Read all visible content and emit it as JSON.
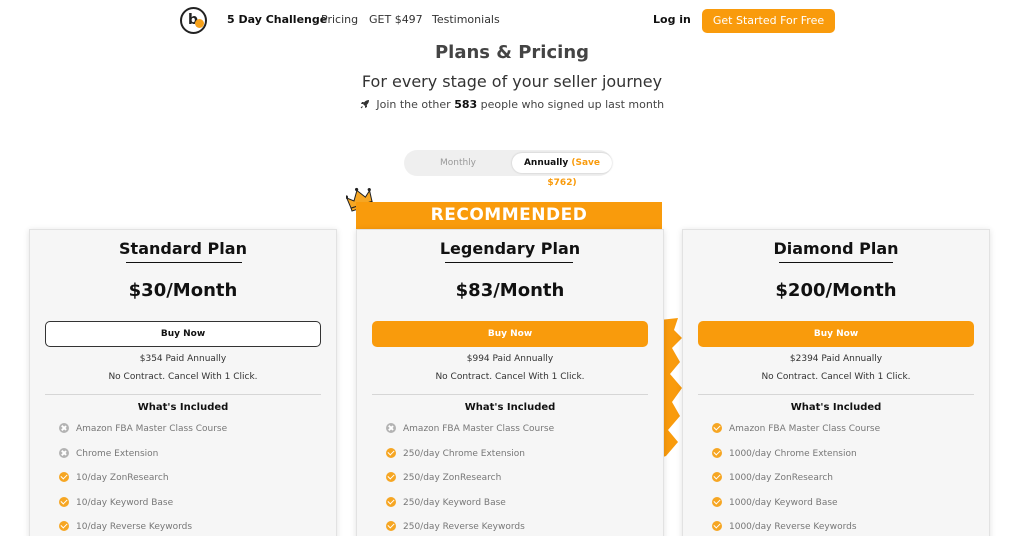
{
  "nav": {
    "links": [
      "5 Day Challenge",
      "Pricing",
      "GET $497",
      "Testimonials"
    ],
    "login": "Log in",
    "cta": "Get Started For Free"
  },
  "hero": {
    "title": "Plans & Pricing",
    "subtitle": "For every stage of your seller journey",
    "note_prefix": "Join the other",
    "note_count": "583",
    "note_suffix": "people who signed up last month"
  },
  "billing_toggle": {
    "monthly": "Monthly",
    "annual": "Annually",
    "save": "(Save $762)",
    "selected": "Annually"
  },
  "recommended_label": "RECOMMENDED",
  "plans": [
    {
      "name": "Standard Plan",
      "price": "$30/Month",
      "buy": "Buy Now",
      "paid": "$354 Paid Annually",
      "contract": "No Contract. Cancel With 1 Click.",
      "included": "What's Included",
      "features": [
        {
          "text": "Amazon FBA Master Class Course",
          "included": false
        },
        {
          "text": "Chrome Extension",
          "included": false
        },
        {
          "text": "10/day ZonResearch",
          "included": true
        },
        {
          "text": "10/day Keyword Base",
          "included": true
        },
        {
          "text": "10/day Reverse Keywords",
          "included": true
        }
      ]
    },
    {
      "name": "Legendary Plan",
      "price": "$83/Month",
      "buy": "Buy Now",
      "paid": "$994 Paid Annually",
      "contract": "No Contract. Cancel With 1 Click.",
      "included": "What's Included",
      "features": [
        {
          "text": "Amazon FBA Master Class Course",
          "included": false
        },
        {
          "text": "250/day Chrome Extension",
          "included": true
        },
        {
          "text": "250/day ZonResearch",
          "included": true
        },
        {
          "text": "250/day Keyword Base",
          "included": true
        },
        {
          "text": "250/day Reverse Keywords",
          "included": true
        }
      ]
    },
    {
      "name": "Diamond Plan",
      "price": "$200/Month",
      "buy": "Buy Now",
      "paid": "$2394 Paid Annually",
      "contract": "No Contract. Cancel With 1 Click.",
      "included": "What's Included",
      "features": [
        {
          "text": "Amazon FBA Master Class Course",
          "included": true
        },
        {
          "text": "1000/day Chrome Extension",
          "included": true
        },
        {
          "text": "1000/day ZonResearch",
          "included": true
        },
        {
          "text": "1000/day Keyword Base",
          "included": true
        },
        {
          "text": "1000/day Reverse Keywords",
          "included": true
        }
      ]
    }
  ],
  "colors": {
    "accent": "#f99b0c",
    "check": "#f6a623",
    "cross": "#b3b3b3"
  }
}
